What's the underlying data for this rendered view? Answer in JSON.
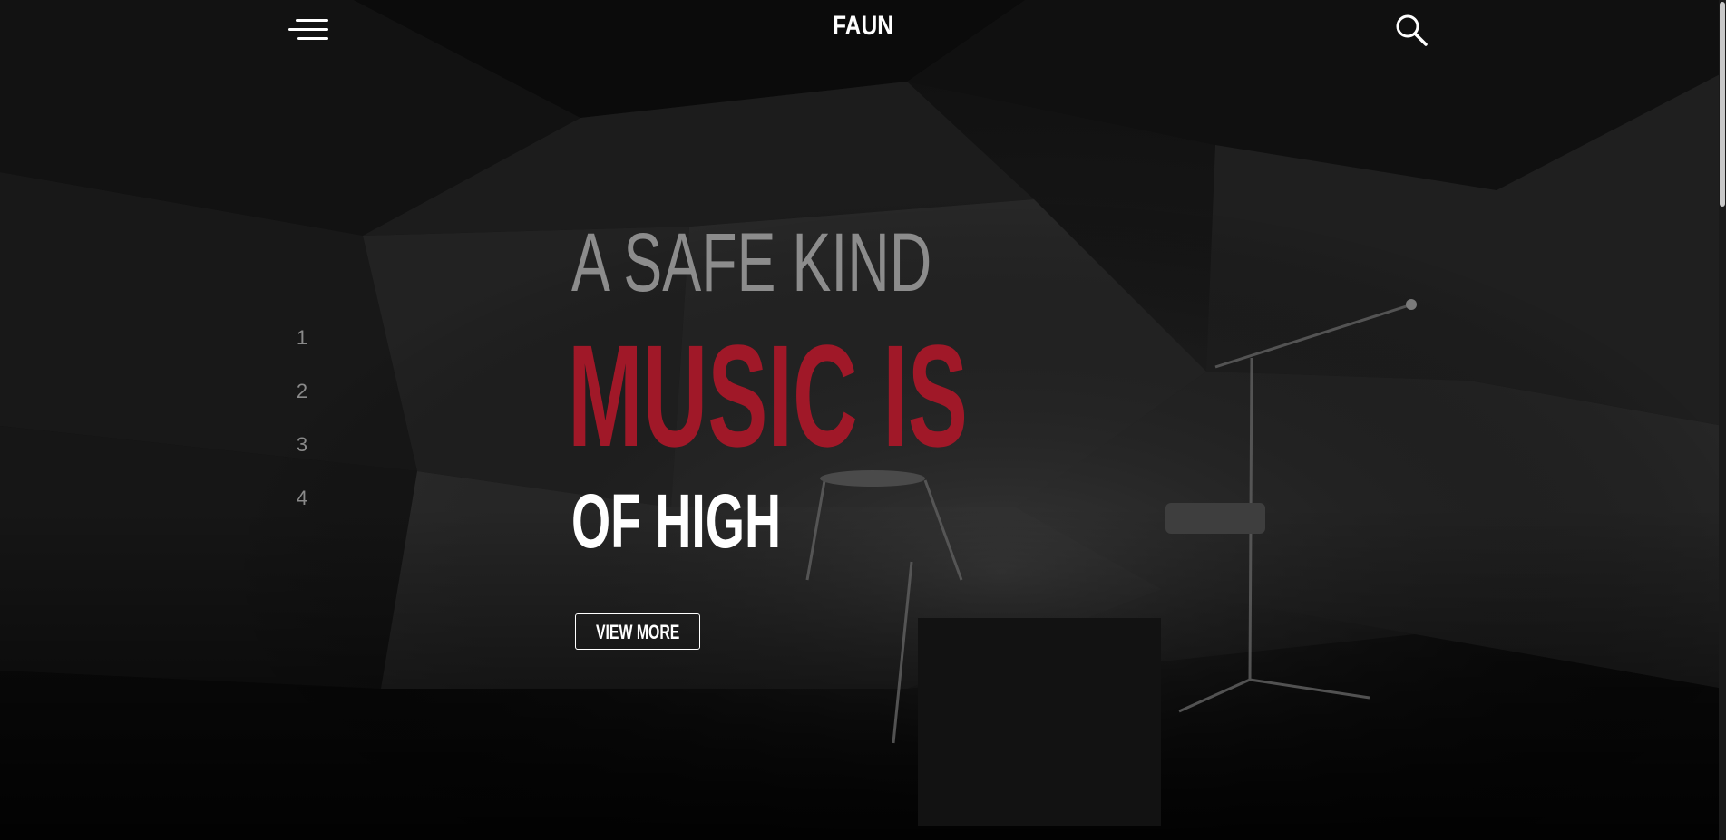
{
  "header": {
    "brand": "FAUN",
    "menu_icon": "hamburger-menu-icon",
    "search_icon": "search-icon"
  },
  "hero": {
    "line1": "A SAFE KIND",
    "line2": "MUSIC IS",
    "line3": "OF HIGH",
    "cta_label": "VIEW MORE",
    "colors": {
      "line1": "#8c8c8c",
      "line2": "#a01828",
      "line3": "#ffffff",
      "background": "#0e0e0e"
    }
  },
  "pager": {
    "items": [
      "1",
      "2",
      "3",
      "4"
    ]
  },
  "background_image": "dark concert stage with microphone stands, stools and amplifier"
}
